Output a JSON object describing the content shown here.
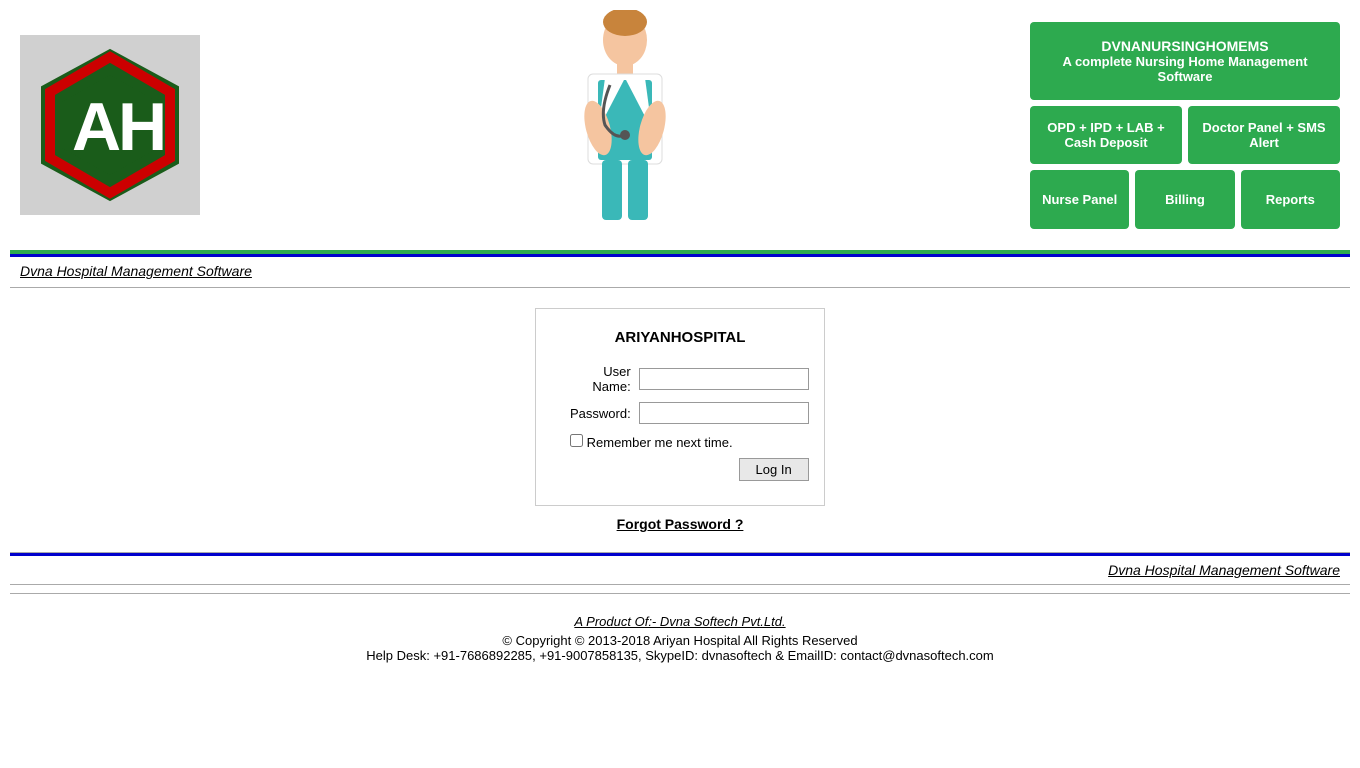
{
  "header": {
    "logo_alt": "AH Logo",
    "app_name": "DVNANURSINGHOMEMS",
    "app_desc": "A complete Nursing Home Management Software",
    "tiles": [
      {
        "id": "opd-ipd-lab",
        "label": "OPD + IPD +  LAB + Cash Deposit"
      },
      {
        "id": "doctor-panel",
        "label": "Doctor Panel + SMS Alert"
      },
      {
        "id": "nurse-panel",
        "label": "Nurse Panel"
      },
      {
        "id": "billing",
        "label": "Billing"
      },
      {
        "id": "reports",
        "label": "Reports"
      }
    ]
  },
  "nav": {
    "top_link": "Dvna Hospital Management Software",
    "bottom_link": "Dvna Hospital Management Software"
  },
  "login": {
    "hospital_name": "ARIYANHOSPITAL",
    "username_label": "User Name:",
    "password_label": "Password:",
    "remember_label": "Remember me next time.",
    "login_button": "Log In",
    "forgot_link": "Forgot Password ?"
  },
  "footer": {
    "product_text": "A Product Of:- Dvna Softech Pvt.Ltd.",
    "copyright": "© Copyright © 2013-2018 Ariyan Hospital All Rights Reserved",
    "helpdesk": "Help Desk: +91-7686892285, +91-9007858135, SkypeID: dvnasoftech & EmailID: contact@dvnasoftech.com"
  }
}
